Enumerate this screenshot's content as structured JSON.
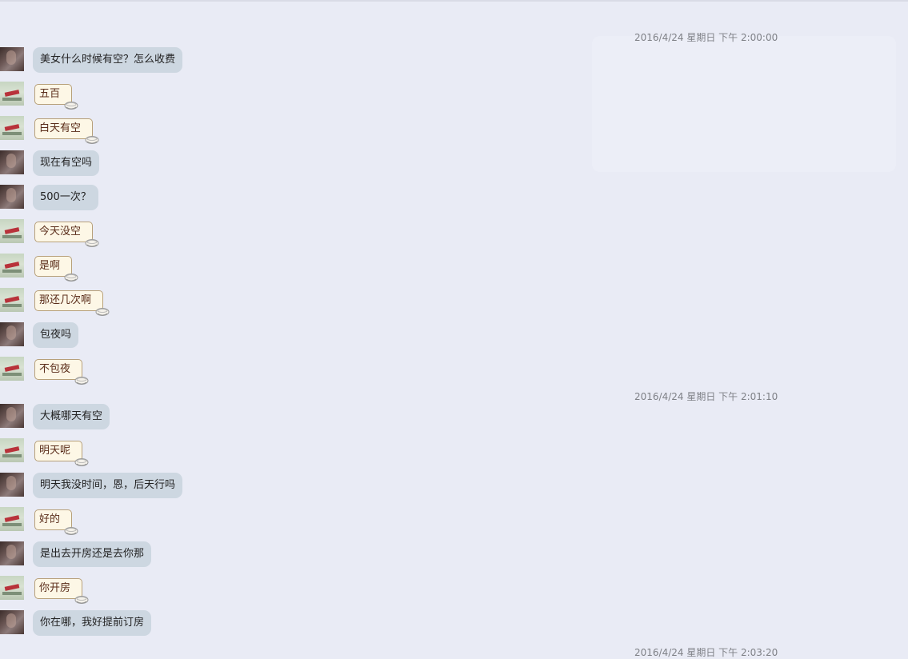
{
  "timestamps": [
    "2016/4/24 星期日 下午 2:00:00",
    "2016/4/24 星期日 下午 2:01:10",
    "2016/4/24 星期日 下午 2:03:20"
  ],
  "messages": [
    {
      "from": "her",
      "text": "美女什么时候有空？怎么收费"
    },
    {
      "from": "him",
      "text": "五百"
    },
    {
      "from": "him",
      "text": "白天有空"
    },
    {
      "from": "her",
      "text": "现在有空吗"
    },
    {
      "from": "her",
      "text": "500一次？"
    },
    {
      "from": "him",
      "text": "今天没空"
    },
    {
      "from": "him",
      "text": "是啊"
    },
    {
      "from": "him",
      "text": "那还几次啊"
    },
    {
      "from": "her",
      "text": "包夜吗"
    },
    {
      "from": "him",
      "text": "不包夜"
    },
    {
      "from": "her",
      "text": "大概哪天有空"
    },
    {
      "from": "him",
      "text": "明天呢"
    },
    {
      "from": "her",
      "text": "明天我没时间，恩，后天行吗"
    },
    {
      "from": "him",
      "text": "好的"
    },
    {
      "from": "her",
      "text": "是出去开房还是去你那"
    },
    {
      "from": "him",
      "text": "你开房"
    },
    {
      "from": "her",
      "text": "你在哪，我好提前订房"
    }
  ],
  "colors": {
    "background": "#e9ebf5",
    "her_bubble": "#cdd7e1",
    "his_bubble": "#fdf7e6",
    "his_bubble_border": "#b7a07a",
    "timestamp": "#7f8187"
  },
  "icons": {
    "his_bubble_decoration": "teacup-icon",
    "her_avatar": "avatar-photo",
    "his_avatar": "avatar-photo"
  }
}
